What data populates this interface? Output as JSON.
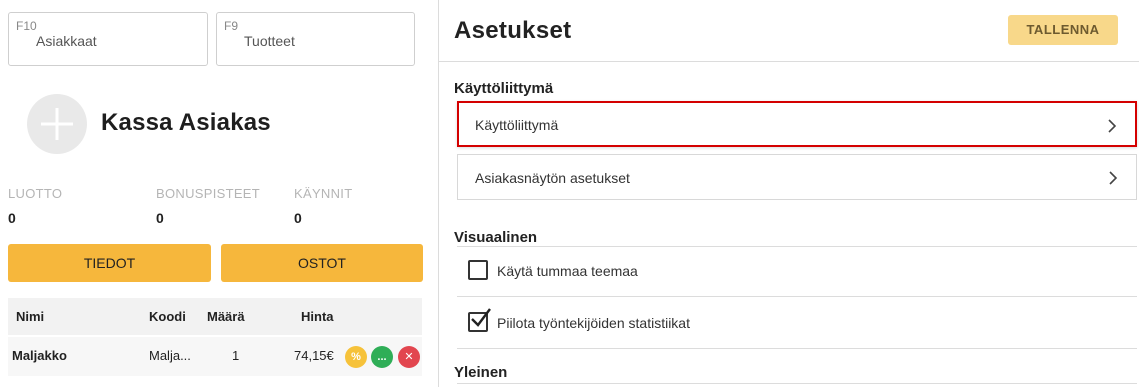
{
  "left": {
    "function_keys": [
      {
        "key": "F10",
        "label": "Asiakkaat"
      },
      {
        "key": "F9",
        "label": "Tuotteet"
      }
    ],
    "customer_name": "Kassa Asiakas",
    "stats": [
      {
        "label": "LUOTTO",
        "value": "0"
      },
      {
        "label": "BONUSPISTEET",
        "value": "0"
      },
      {
        "label": "KÄYNNIT",
        "value": "0"
      }
    ],
    "buttons": {
      "tiedot": "TIEDOT",
      "ostot": "OSTOT"
    },
    "table": {
      "columns": [
        "Nimi",
        "Koodi",
        "Määrä",
        "Hinta"
      ],
      "rows": [
        {
          "nimi": "Maljakko",
          "koodi": "Malja...",
          "maara": "1",
          "hinta": "74,15€",
          "actions": [
            {
              "icon": "percent-icon",
              "glyph": "%",
              "color": "#f6c23a"
            },
            {
              "icon": "more-icon",
              "glyph": "...",
              "color": "#2fae57"
            },
            {
              "icon": "close-icon",
              "glyph": "✕",
              "color": "#e2464f"
            }
          ]
        }
      ]
    }
  },
  "right": {
    "title": "Asetukset",
    "save_label": "TALLENNA",
    "sections": {
      "kayttoliittyma": {
        "heading": "Käyttöliittymä",
        "items": [
          "Käyttöliittymä",
          "Asiakasnäytön asetukset"
        ]
      },
      "visuaalinen": {
        "heading": "Visuaalinen",
        "checkboxes": [
          {
            "label": "Käytä tummaa teemaa",
            "checked": false
          },
          {
            "label": "Piilota työntekijöiden statistiikat",
            "checked": true
          }
        ]
      },
      "yleinen": {
        "heading": "Yleinen"
      }
    }
  },
  "colors": {
    "accent_yellow": "#f6b73c",
    "save_button": "#f8d88a",
    "highlight_border": "#d40000"
  }
}
